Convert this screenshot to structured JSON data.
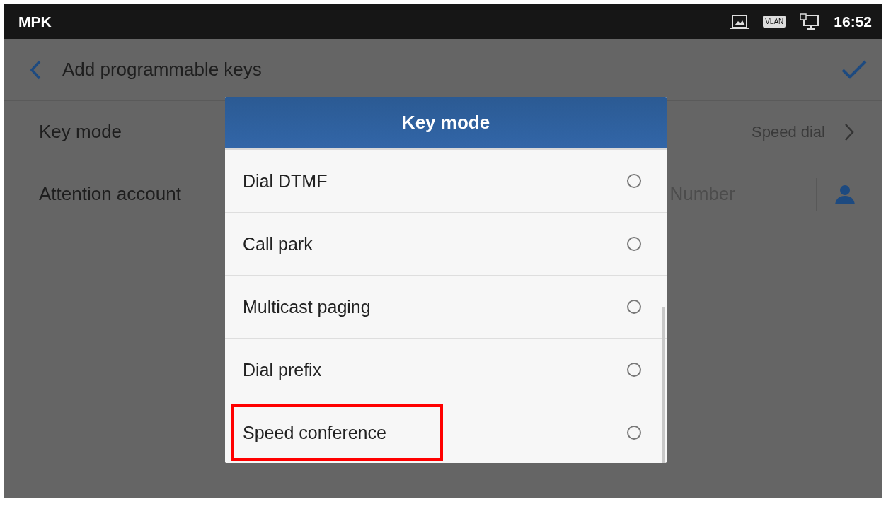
{
  "status_bar": {
    "title": "MPK",
    "time": "16:52",
    "vlan": "VLAN"
  },
  "header": {
    "title": "Add programmable keys"
  },
  "settings": [
    {
      "kind": "link",
      "label": "Key mode",
      "value": "Speed dial"
    },
    {
      "kind": "account",
      "label": "Attention account",
      "value": "Number"
    }
  ],
  "dialog": {
    "title": "Key mode",
    "options": [
      {
        "label": "Dial DTMF",
        "selected": false,
        "highlighted": false
      },
      {
        "label": "Call park",
        "selected": false,
        "highlighted": false
      },
      {
        "label": "Multicast paging",
        "selected": false,
        "highlighted": false
      },
      {
        "label": "Dial prefix",
        "selected": false,
        "highlighted": false
      },
      {
        "label": "Speed conference",
        "selected": false,
        "highlighted": true
      }
    ]
  }
}
